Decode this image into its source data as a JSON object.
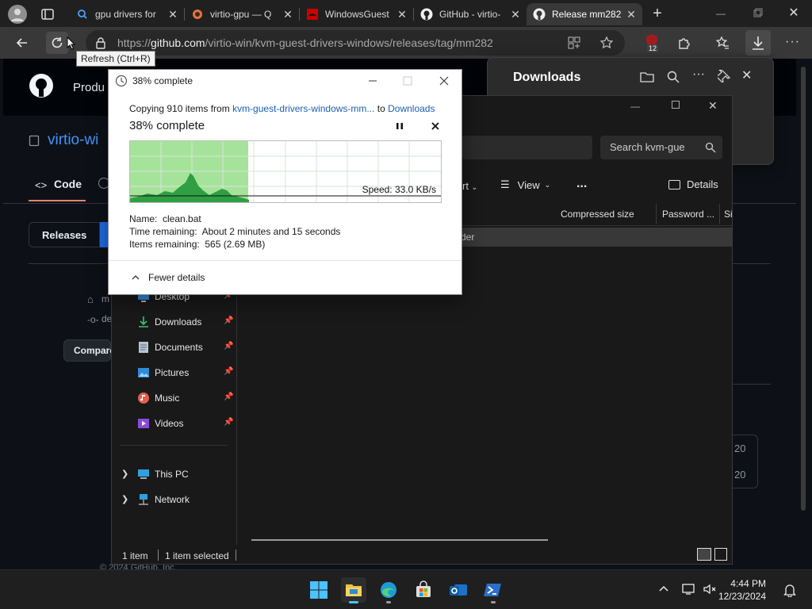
{
  "browser": {
    "tabs": [
      {
        "label": "gpu drivers for",
        "active": false
      },
      {
        "label": "virtio-gpu — Q",
        "active": false
      },
      {
        "label": "WindowsGuest",
        "active": false
      },
      {
        "label": "GitHub - virtio-",
        "active": false
      },
      {
        "label": "Release mm282",
        "active": true
      }
    ],
    "url_prefix": "https://",
    "url_domain": "github.com",
    "url_path": "/virtio-win/kvm-guest-drivers-windows/releases/tag/mm282",
    "extension_badge": "12",
    "tooltip": "Refresh (Ctrl+R)"
  },
  "github": {
    "product_label": "Produ",
    "repo_label": "virtio-wi",
    "code_tab": "Code",
    "releases_button": "Releases",
    "tag_label": "m",
    "commit_label": "de",
    "compare_button": "Compare",
    "right_val_1": "20",
    "right_val_2": "20",
    "footer_text": "© 2024 GitHub, Inc."
  },
  "downloads_panel": {
    "title": "Downloads"
  },
  "explorer": {
    "search_placeholder": "Search kvm-gue",
    "sort_label": "rt",
    "view_label": "View",
    "more_label": "...",
    "details_label": "Details",
    "columns": [
      "Compressed size",
      "Password ...",
      "Si"
    ],
    "folder_hint": "der",
    "nav_items": [
      {
        "label": "Desktop",
        "icon": "desktop-icon",
        "pinned": true
      },
      {
        "label": "Downloads",
        "icon": "download-icon",
        "pinned": true
      },
      {
        "label": "Documents",
        "icon": "documents-icon",
        "pinned": true
      },
      {
        "label": "Pictures",
        "icon": "pictures-icon",
        "pinned": true
      },
      {
        "label": "Music",
        "icon": "music-icon",
        "pinned": true
      },
      {
        "label": "Videos",
        "icon": "videos-icon",
        "pinned": true
      }
    ],
    "this_pc": "This PC",
    "network": "Network",
    "status_items": "1 item",
    "status_selected": "1 item selected"
  },
  "copy_dialog": {
    "title": "38% complete",
    "copying_prefix": "Copying 910 items from ",
    "source": "kvm-guest-drivers-windows-mm...",
    "to_word": " to ",
    "destination": "Downloads",
    "big_status": "38% complete",
    "progress_fraction": 0.38,
    "speed": "Speed: 33.0 KB/s",
    "name_label": "Name:",
    "name_value": "clean.bat",
    "time_label": "Time remaining:",
    "time_value": "About 2 minutes and 15 seconds",
    "items_label": "Items remaining:",
    "items_value": "565 (2.69 MB)",
    "fewer_details": "Fewer details",
    "colors": {
      "graph_fill": "#a6e39a",
      "graph_area": "#2ea043",
      "link": "#1a5fb4"
    }
  },
  "taskbar": {
    "time": "4:44 PM",
    "date": "12/23/2024"
  }
}
